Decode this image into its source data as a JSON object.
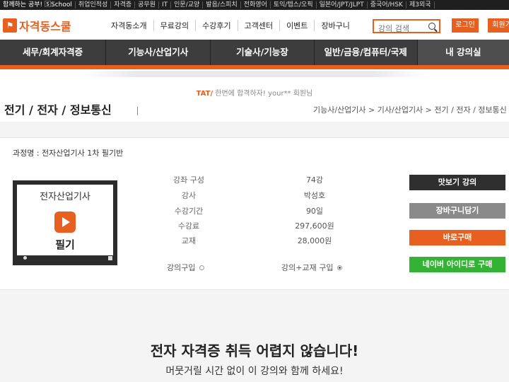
{
  "topbar": {
    "brand": "함께하는 공부! 🅂School",
    "items": [
      "취업인적성",
      "자격증",
      "공무원",
      "IT",
      "인문/교양",
      "발음/스피치",
      "전화영어",
      "토익/텝스/오픽",
      "일본어/JPT/JLPT",
      "중국어/HSK",
      "제3외국"
    ]
  },
  "header": {
    "logo_text": "자격동스쿨",
    "logo_mark": "⚑",
    "nav": [
      "자격동소개",
      "무료강의",
      "수강후기",
      "고객센터",
      "이벤트",
      "장바구니"
    ],
    "search_placeholder": "강의 검색",
    "login_label": "로그인",
    "join_label": "회원가"
  },
  "categories": [
    "세무/회계자격증",
    "기능사/산업기사",
    "기술사/기능장",
    "일반/금융/컴퓨터/국제",
    "내 강의실"
  ],
  "banner": {
    "line_prefix": "TAT/",
    "line_text": " 한번에 합격하자! your** 회원님"
  },
  "page": {
    "title": "전기 / 전자 / 정보통신",
    "breadcrumb": "기능사/산업기사 > 기사/산업기사 > 전기 / 전자 / 정보통신"
  },
  "course": {
    "name_label": "과정명 : 전자산업기사 1차 필기반",
    "thumb_title": "전자산업기사",
    "thumb_sub": "필기",
    "info": [
      {
        "label": "강좌 구성",
        "value": "74강"
      },
      {
        "label": "강사",
        "value": "박성호"
      },
      {
        "label": "수강기간",
        "value": "90일"
      },
      {
        "label": "수강료",
        "value": "297,600원"
      },
      {
        "label": "교재",
        "value": "28,000원"
      }
    ],
    "option1": "강의구입",
    "option2": "강의+교재 구입",
    "selected_option": "강의+교재 구입"
  },
  "actions": {
    "preview": "맛보기 강의",
    "cart": "장바구니담기",
    "buy": "바로구매",
    "naver": "네이버 아이디로 구매"
  },
  "colors": {
    "accent": "#e8601f",
    "dark": "#2f2f2f",
    "gray": "#8a8a8a",
    "green": "#34b233"
  },
  "promo": {
    "headline": "전자 자격증 취득 어렵지 않습니다!",
    "sub": "머뭇거릴 시간 없이 이 강의와 함께 하세요!"
  }
}
